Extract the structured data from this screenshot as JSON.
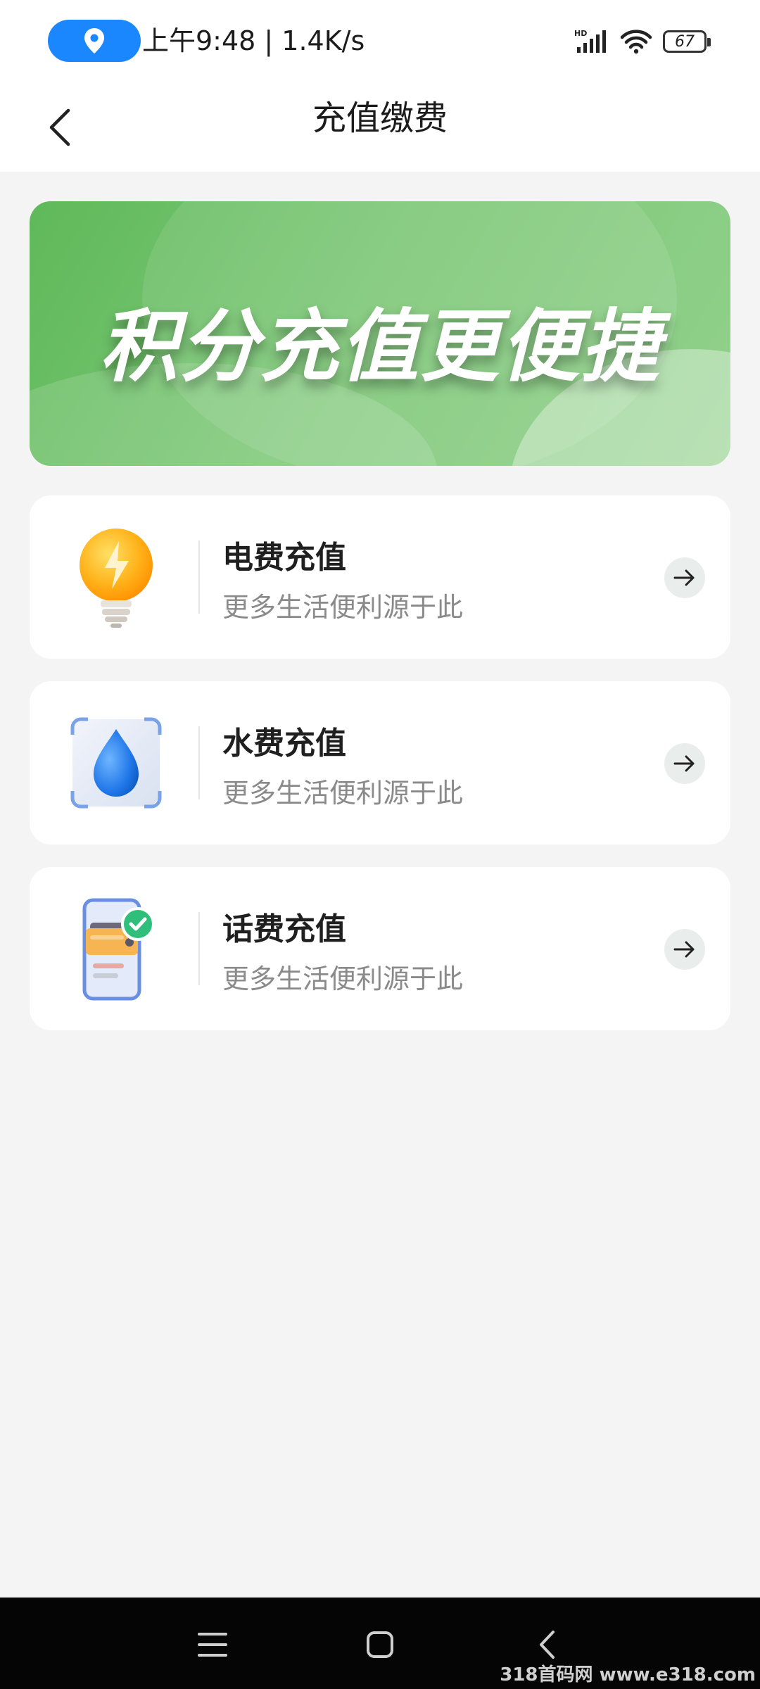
{
  "status_bar": {
    "text": "上午9:48 | 1.4K/s",
    "network_label": "HD",
    "battery": "67"
  },
  "header": {
    "title": "充值缴费"
  },
  "banner": {
    "text": "积分充值更便捷"
  },
  "services": [
    {
      "title": "电费充值",
      "subtitle": "更多生活便利源于此",
      "icon": "lightbulb-icon"
    },
    {
      "title": "水费充值",
      "subtitle": "更多生活便利源于此",
      "icon": "water-drop-icon"
    },
    {
      "title": "话费充值",
      "subtitle": "更多生活便利源于此",
      "icon": "phone-bill-icon"
    }
  ],
  "watermark": "318首码网 www.e318.com",
  "colors": {
    "accent_blue": "#1a87ff",
    "banner_green": "#7cc776",
    "background": "#f4f4f4"
  }
}
